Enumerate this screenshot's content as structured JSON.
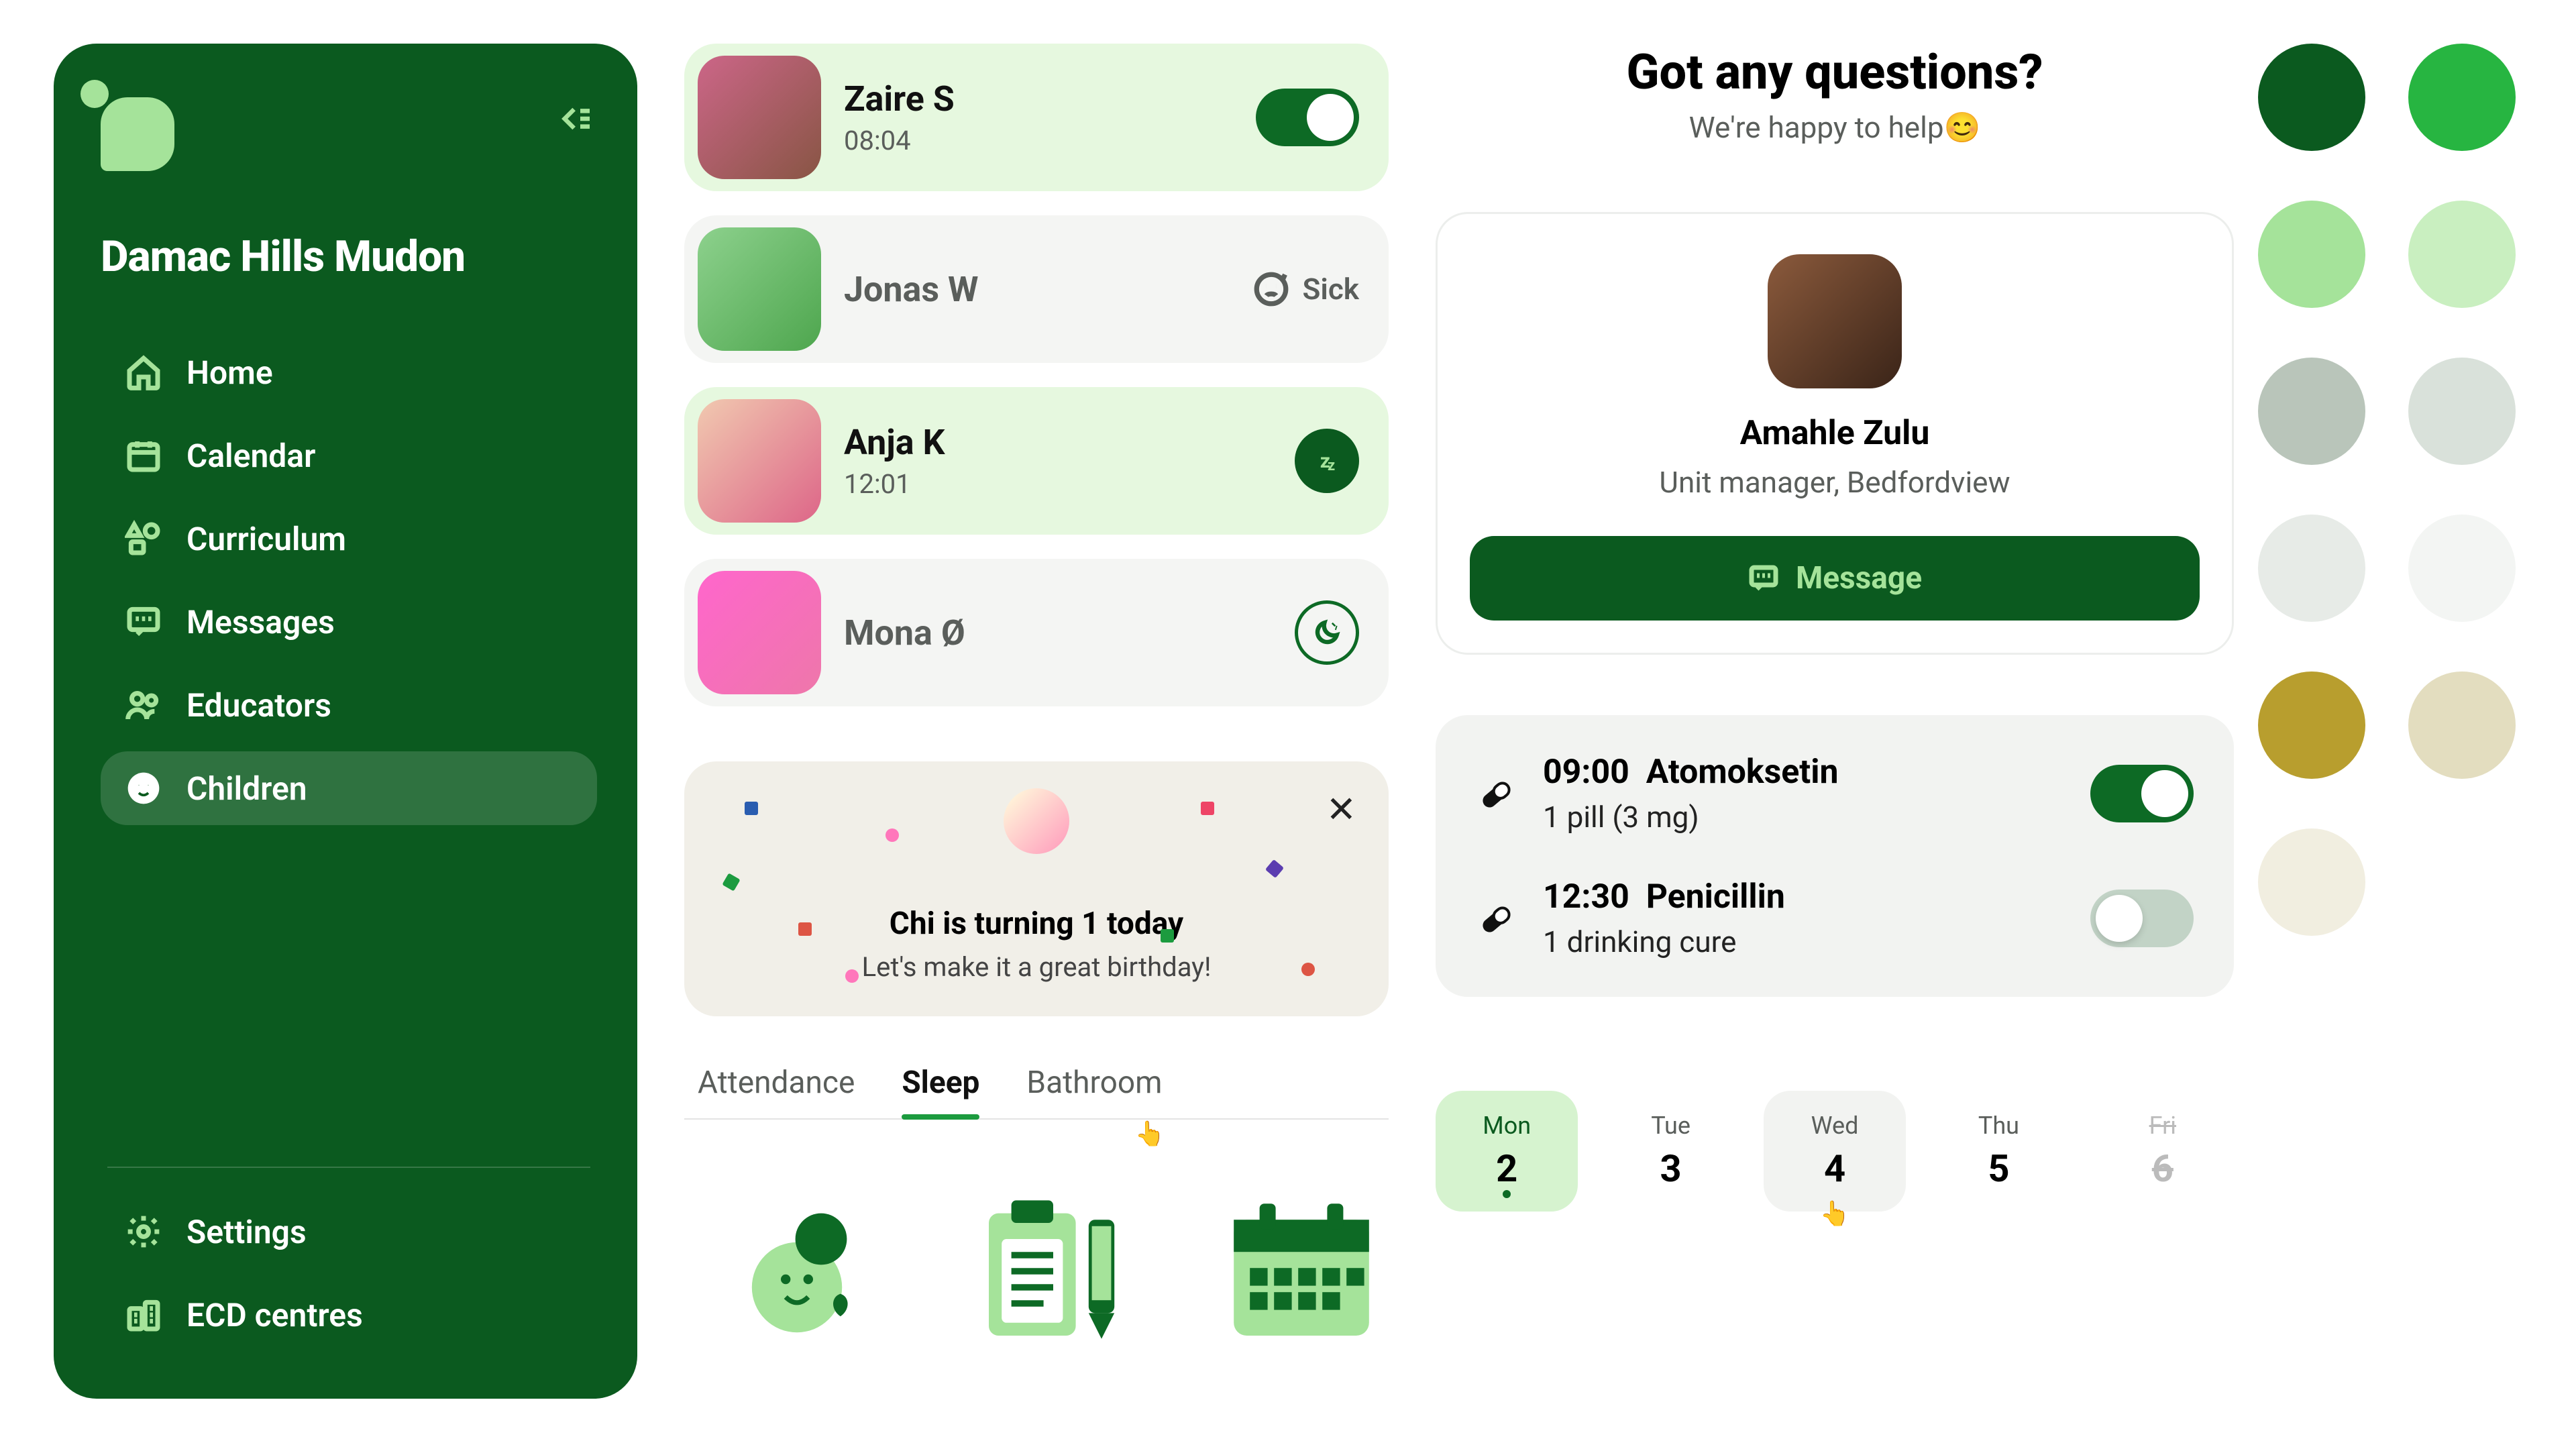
{
  "sidebar": {
    "org_name": "Damac Hills Mudon",
    "items": [
      {
        "label": "Home",
        "icon": "home-icon"
      },
      {
        "label": "Calendar",
        "icon": "calendar-icon"
      },
      {
        "label": "Curriculum",
        "icon": "shapes-icon"
      },
      {
        "label": "Messages",
        "icon": "chat-icon"
      },
      {
        "label": "Educators",
        "icon": "people-icon"
      },
      {
        "label": "Children",
        "icon": "child-face-icon",
        "active": true
      }
    ],
    "footer_items": [
      {
        "label": "Settings",
        "icon": "gear-icon"
      },
      {
        "label": "ECD centres",
        "icon": "buildings-icon"
      }
    ]
  },
  "children_list": [
    {
      "name": "Zaire S",
      "time": "08:04",
      "status": "toggle-on",
      "highlight": true
    },
    {
      "name": "Jonas W",
      "status": "sick",
      "status_label": "Sick"
    },
    {
      "name": "Anja K",
      "time": "12:01",
      "status": "sleeping",
      "highlight": true
    },
    {
      "name": "Mona Ø",
      "status": "night"
    }
  ],
  "birthday": {
    "title": "Chi is turning 1 today",
    "subtitle": "Let's make it a great birthday!"
  },
  "tabs": [
    {
      "label": "Attendance"
    },
    {
      "label": "Sleep",
      "active": true
    },
    {
      "label": "Bathroom",
      "cursor": true
    }
  ],
  "questions": {
    "title": "Got any questions?",
    "subtitle": "We're happy to help😊",
    "contact_name": "Amahle Zulu",
    "contact_role": "Unit manager, Bedfordview",
    "button": "Message"
  },
  "medication": [
    {
      "time": "09:00",
      "name": "Atomoksetin",
      "dose": "1 pill (3 mg)",
      "on": true
    },
    {
      "time": "12:30",
      "name": "Penicillin",
      "dose": "1 drinking cure",
      "on": false
    }
  ],
  "week": [
    {
      "dow": "Mon",
      "num": "2",
      "state": "selected"
    },
    {
      "dow": "Tue",
      "num": "3",
      "state": "normal"
    },
    {
      "dow": "Wed",
      "num": "4",
      "state": "hover",
      "cursor": true
    },
    {
      "dow": "Thu",
      "num": "5",
      "state": "normal"
    },
    {
      "dow": "Fri",
      "num": "6",
      "state": "disabled"
    }
  ],
  "palette": [
    "#0b5a1f",
    "#27b541",
    "#a5e39a",
    "#c9efc0",
    "#b9c5ba",
    "#d9e1da",
    "#e7ebe7",
    "#f3f5f3",
    "#b89e2e",
    "#e3ddbf",
    "#f1eee0",
    "#ffffff"
  ]
}
